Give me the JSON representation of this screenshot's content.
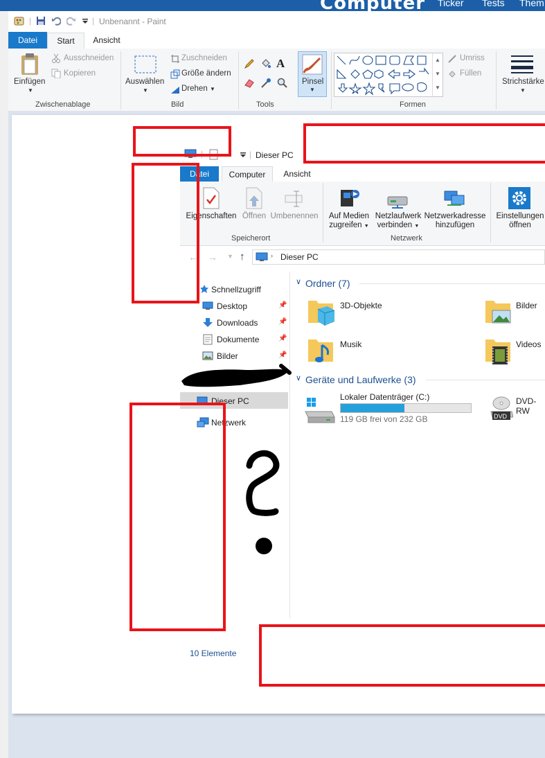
{
  "site": {
    "logo": "Computer",
    "nav": [
      "Ticker",
      "Tests",
      "Them"
    ]
  },
  "paint": {
    "title": "Unbenannt - Paint",
    "tabs": [
      "Datei",
      "Start",
      "Ansicht"
    ],
    "groups": {
      "clipboard": {
        "label": "Zwischenablage",
        "paste": "Einfügen",
        "cut": "Ausschneiden",
        "copy": "Kopieren"
      },
      "image": {
        "label": "Bild",
        "select": "Auswählen",
        "crop": "Zuschneiden",
        "resize": "Größe ändern",
        "rotate": "Drehen"
      },
      "tools": {
        "label": "Tools",
        "brush": "Pinsel"
      },
      "shapes": {
        "label": "Formen",
        "outline": "Umriss",
        "fill": "Füllen"
      },
      "size": {
        "label": "Strichstärke"
      }
    }
  },
  "explorer": {
    "title": "Dieser PC",
    "tabs": [
      "Datei",
      "Computer",
      "Ansicht"
    ],
    "ribbon": {
      "buttons": [
        "Eigenschaften",
        "Öffnen",
        "Umbenennen"
      ],
      "group1": "Speicherort",
      "net": [
        [
          "Auf Medien",
          "zugreifen"
        ],
        [
          "Netzlaufwerk",
          "verbinden"
        ],
        [
          "Netzwerkadresse",
          "hinzufügen"
        ]
      ],
      "group2": "Netzwerk",
      "settings": [
        "Einstellungen",
        "öffnen"
      ]
    },
    "address": "Dieser PC",
    "nav": {
      "quick": "Schnellzugriff",
      "items": [
        "Desktop",
        "Downloads",
        "Dokumente",
        "Bilder"
      ],
      "thispc": "Dieser PC",
      "network": "Netzwerk"
    },
    "folders_header": "Ordner (7)",
    "folders": [
      "3D-Objekte",
      "Bilder",
      "Musik",
      "Videos"
    ],
    "drives_header": "Geräte und Laufwerke (3)",
    "drive": {
      "name": "Lokaler Datenträger (C:)",
      "free": "119 GB frei von 232 GB",
      "used_fraction": 0.49
    },
    "dvd": "DVD-RW",
    "dvd_badge": "DVD",
    "status": "10 Elemente"
  },
  "annotation": {
    "question_mark": "?"
  }
}
